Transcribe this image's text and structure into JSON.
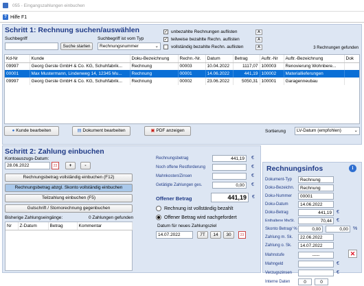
{
  "window": {
    "title": "055 - Eingangszahlungen einbuchen",
    "icon": "app-icon"
  },
  "toolbar": {
    "help_label": "Hilfe F1"
  },
  "search": {
    "heading": "Schritt 1: Rechnung suchen/auswählen",
    "term_label": "Suchbegriff",
    "term_value": "",
    "start_label": "Suche starten",
    "vorgang_label": "Suchbegriff ist vom Typ",
    "vorgang_value": "Rechnungsnummer",
    "filters": [
      {
        "label": "unbezahlte Rechnungen auflisten",
        "checked": "✓",
        "btn": "A"
      },
      {
        "label": "teilweise bezahlte Rechn.  auflisten",
        "checked": "✓",
        "btn": "A"
      },
      {
        "label": "vollständig bezahlte Rechn.  auflisten",
        "checked": "",
        "btn": "A"
      }
    ],
    "found": "3 Rechnungen gefunden"
  },
  "table": {
    "columns": [
      "Kd-Nr",
      "Kunde",
      "Doku-Bezeichnung",
      "Rechn.-Nr.",
      "Datum",
      "Betrag",
      "Auftr.-Nr",
      "Auftr.-Bezeichnung",
      "Dok"
    ],
    "rows": [
      [
        "09997",
        "Georg Gerste GmbH & Co. KG, Schuhfabrik...",
        "Rechnung",
        "00003",
        "10.04.2022",
        "1117,07",
        "100003",
        "Renovierung Wohnbere..."
      ],
      [
        "00001",
        "Max Mustermann, Lindenweg 14, 12345 Mu...",
        "Rechnung",
        "00001",
        "14.06.2022",
        "441,19",
        "100002",
        "Materiallieferungen"
      ],
      [
        "09997",
        "Georg Gerste GmbH & Co. KG, Schuhfabrik...",
        "Rechnung",
        "00002",
        "23.06.2022",
        "5050,31",
        "100001",
        "Garagenneubau"
      ]
    ]
  },
  "actions": {
    "edit_customer": "Kunde bearbeiten",
    "edit_document": "Dokument bearbeiten",
    "pdf": "PDF anzeigen",
    "sort_label": "Sortierung",
    "sort_value": "LV-Datum (empfohlen)"
  },
  "payment": {
    "heading": "Schritt 2: Zahlung einbuchen",
    "date_label": "Kontoauszugs-Datum:",
    "date_value": "28.06.2022",
    "plus": "+",
    "minus": "-",
    "book_full": "Rechnungsbetrag vollständig einbuchen (F12)",
    "book_skonto": "Rechnungsbetrag abzgl. Skonto vollständig einbuchen",
    "book_partial": "Teilzahlung einbuchen (F5)",
    "book_credit": "Gutschrift / Stornorechnung gegenbuchen",
    "prev_label": "Bisherige Zahlungseingänge:",
    "prev_found": "0 Zahlungen gefunden",
    "prev_columns": [
      "Nr",
      "Z-Datum",
      "Betrag",
      "Kommentar"
    ],
    "fields": [
      {
        "label": "Rechnungsbetrag",
        "value": "441,19",
        "cur": "€"
      },
      {
        "label": "Noch offene Restforderung",
        "value": "",
        "cur": "€"
      },
      {
        "label": "Mahnkosten/Zinsen",
        "value": "",
        "cur": "€"
      },
      {
        "label": "Getätigte Zahlungen ges.",
        "value": "0,00",
        "cur": "€"
      }
    ],
    "open_label": "Offener Betrag",
    "open_value": "441,19",
    "open_cur": "€",
    "radio_full": "Rechnung ist vollständig bezahlt",
    "radio_open": "Offener Betrag wird nachgefordert",
    "deadline_label": "Datum für neues Zahlungsziel",
    "deadline_value": "14.07.2022",
    "days": [
      "7T",
      "14",
      "30"
    ]
  },
  "info": {
    "heading": "Rechnungsinfos",
    "rows": [
      {
        "label": "Dokument-Typ",
        "value": "Rechnung"
      },
      {
        "label": "Doku-Bezeichn.",
        "value": "Rechnung"
      },
      {
        "label": "Doku-Nummer",
        "value": "00001"
      },
      {
        "label": "Doku-Datum",
        "value": "14.06.2022"
      },
      {
        "label": "Doku-Betrag",
        "value": "441,19",
        "cur": "€"
      },
      {
        "label": "Enthaltene MwSt.",
        "value": "70,44",
        "cur": "€"
      }
    ],
    "skonto_label": "Skonto Betrag/ %",
    "skonto_value": "0,00",
    "skonto_pct": "0,00",
    "skonto_pct_unit": "%",
    "rows2": [
      {
        "label": "Zahlung m. Sk.",
        "value": "22.06.2022"
      },
      {
        "label": "Zahlung o. Sk.",
        "value": "14.07.2022"
      }
    ],
    "mahnstufe_label": "Mahnstufe",
    "mahnstufe_value": "-----",
    "mahngeld_label": "Mahngeld",
    "mahngeld_cur": "€",
    "zinsen_label": "Verzugszinsen",
    "zinsen_cur": "€",
    "intern_label": "Interne Daten",
    "intern_a": "0",
    "intern_b": "0"
  },
  "colors": {
    "heading": "#1f3a86",
    "selection": "#0a6fd6",
    "panel": "#dde6f3"
  }
}
